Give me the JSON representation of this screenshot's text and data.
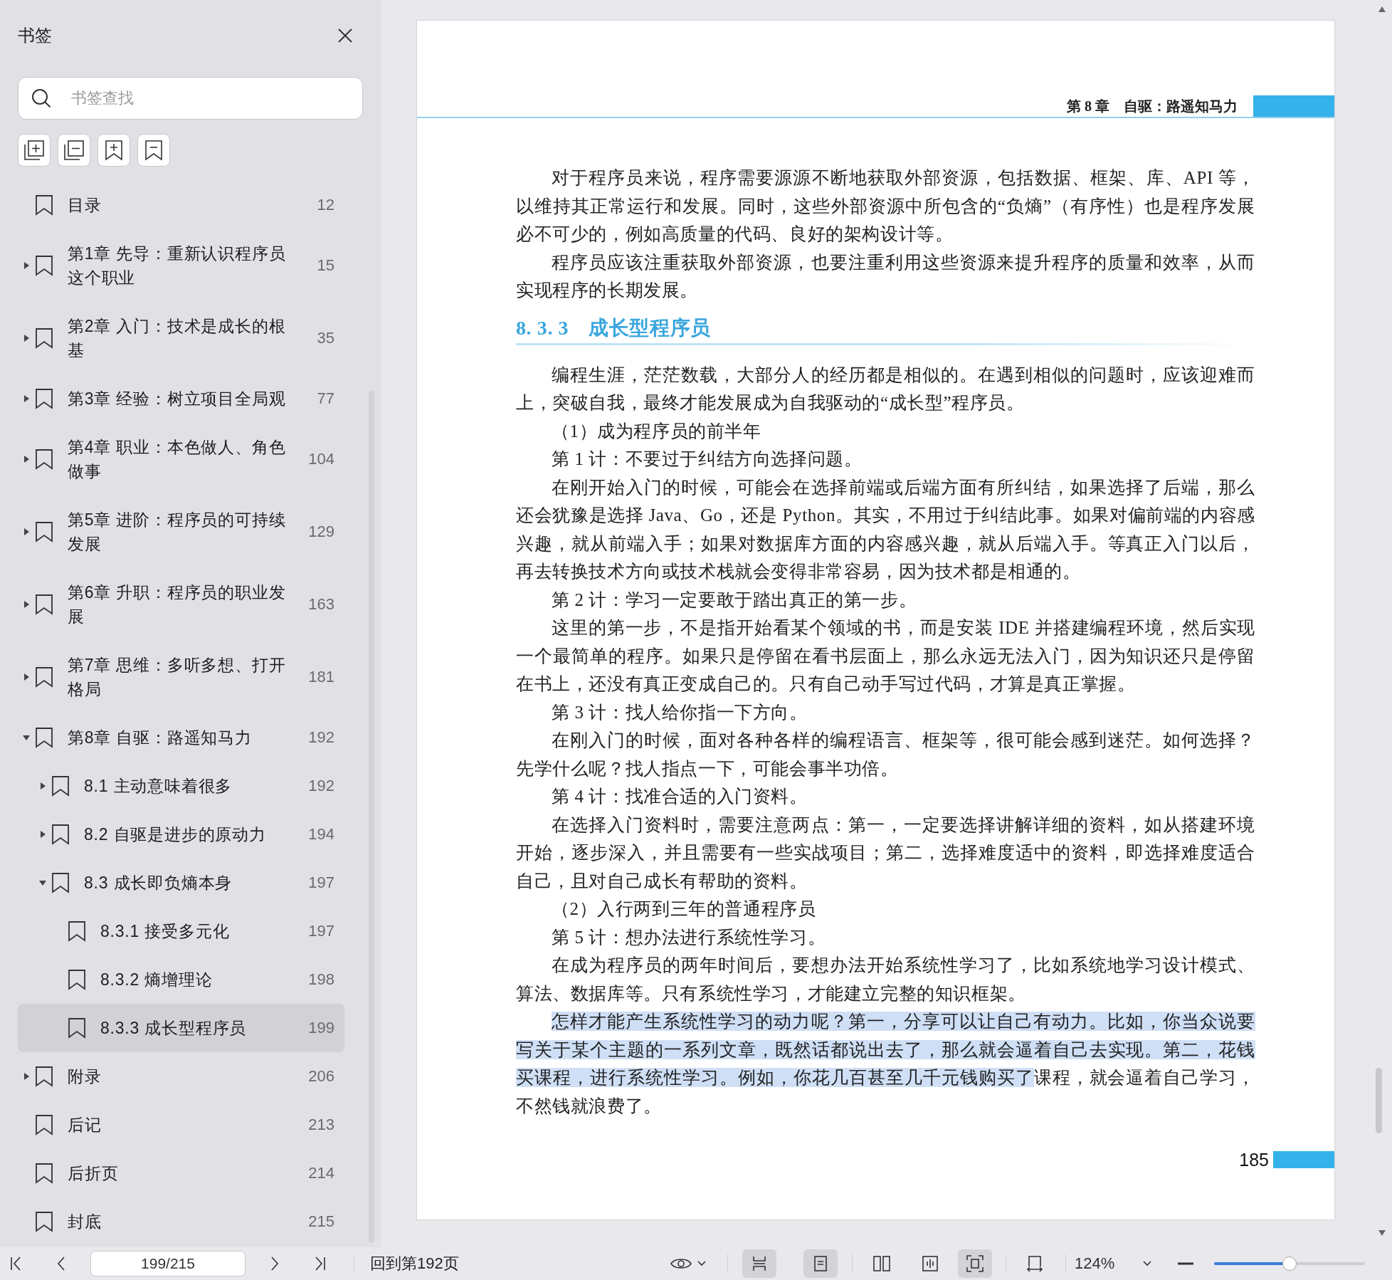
{
  "sidebar": {
    "title": "书签",
    "search": {
      "placeholder": "书签查找"
    },
    "bookmarks": [
      {
        "label": "目录",
        "page": "12",
        "selected": false
      },
      {
        "label": "第1章 先导：重新认识程序员这个职业",
        "page": "15",
        "selected": false,
        "expanded": false
      },
      {
        "label": "第2章 入门：技术是成长的根基",
        "page": "35",
        "selected": false,
        "expanded": false
      },
      {
        "label": "第3章 经验：树立项目全局观",
        "page": "77",
        "selected": false,
        "expanded": false
      },
      {
        "label": "第4章 职业：本色做人、角色做事",
        "page": "104",
        "selected": false,
        "expanded": false
      },
      {
        "label": "第5章 进阶：程序员的可持续发展",
        "page": "129",
        "selected": false,
        "expanded": false
      },
      {
        "label": "第6章 升职：程序员的职业发展",
        "page": "163",
        "selected": false,
        "expanded": false
      },
      {
        "label": "第7章 思维：多听多想、打开格局",
        "page": "181",
        "selected": false,
        "expanded": false
      },
      {
        "label": "第8章 自驱：路遥知马力",
        "page": "192",
        "selected": false,
        "expanded": true,
        "children": [
          {
            "label": "8.1 主动意味着很多",
            "page": "192",
            "selected": false,
            "expanded": false
          },
          {
            "label": "8.2 自驱是进步的原动力",
            "page": "194",
            "selected": false,
            "expanded": false
          },
          {
            "label": "8.3 成长即负熵本身",
            "page": "197",
            "selected": false,
            "expanded": true,
            "children": [
              {
                "label": "8.3.1 接受多元化",
                "page": "197",
                "selected": false
              },
              {
                "label": "8.3.2 熵增理论",
                "page": "198",
                "selected": false
              },
              {
                "label": "8.3.3 成长型程序员",
                "page": "199",
                "selected": true
              }
            ]
          }
        ]
      },
      {
        "label": "附录",
        "page": "206",
        "selected": false,
        "expanded": false
      },
      {
        "label": "后记",
        "page": "213",
        "selected": false
      },
      {
        "label": "后折页",
        "page": "214",
        "selected": false
      },
      {
        "label": "封底",
        "page": "215",
        "selected": false
      }
    ]
  },
  "page": {
    "running_head": "第 8 章　自驱：路遥知马力",
    "page_number": "185",
    "blocks": [
      {
        "kind": "paragraph",
        "text": "对于程序员来说，程序需要源源不断地获取外部资源，包括数据、框架、库、API 等，以维持其正常运行和发展。同时，这些外部资源中所包含的“负熵”（有序性）也是程序发展必不可少的，例如高质量的代码、良好的架构设计等。"
      },
      {
        "kind": "paragraph",
        "text": "程序员应该注重获取外部资源，也要注重利用这些资源来提升程序的质量和效率，从而实现程序的长期发展。"
      },
      {
        "kind": "heading",
        "number": "8. 3. 3",
        "text": "成长型程序员"
      },
      {
        "kind": "paragraph",
        "text": "编程生涯，茫茫数载，大部分人的经历都是相似的。在遇到相似的问题时，应该迎难而上，突破自我，最终才能发展成为自我驱动的“成长型”程序员。"
      },
      {
        "kind": "paragraph",
        "text": "（1）成为程序员的前半年"
      },
      {
        "kind": "paragraph",
        "text": "第 1 计：不要过于纠结方向选择问题。"
      },
      {
        "kind": "paragraph",
        "text": "在刚开始入门的时候，可能会在选择前端或后端方面有所纠结，如果选择了后端，那么还会犹豫是选择 Java、Go，还是 Python。其实，不用过于纠结此事。如果对偏前端的内容感兴趣，就从前端入手；如果对数据库方面的内容感兴趣，就从后端入手。等真正入门以后，再去转换技术方向或技术栈就会变得非常容易，因为技术都是相通的。"
      },
      {
        "kind": "paragraph",
        "text": "第 2 计：学习一定要敢于踏出真正的第一步。"
      },
      {
        "kind": "paragraph",
        "text": "这里的第一步，不是指开始看某个领域的书，而是安装 IDE 并搭建编程环境，然后实现一个最简单的程序。如果只是停留在看书层面上，那么永远无法入门，因为知识还只是停留在书上，还没有真正变成自己的。只有自己动手写过代码，才算是真正掌握。"
      },
      {
        "kind": "paragraph",
        "text": "第 3 计：找人给你指一下方向。"
      },
      {
        "kind": "paragraph",
        "text": "在刚入门的时候，面对各种各样的编程语言、框架等，很可能会感到迷茫。如何选择？先学什么呢？找人指点一下，可能会事半功倍。"
      },
      {
        "kind": "paragraph",
        "text": "第 4 计：找准合适的入门资料。"
      },
      {
        "kind": "paragraph",
        "text": "在选择入门资料时，需要注意两点：第一，一定要选择讲解详细的资料，如从搭建环境开始，逐步深入，并且需要有一些实战项目；第二，选择难度适中的资料，即选择难度适合自己，且对自己成长有帮助的资料。"
      },
      {
        "kind": "paragraph",
        "text": "（2）入行两到三年的普通程序员"
      },
      {
        "kind": "paragraph",
        "text": "第 5 计：想办法进行系统性学习。"
      },
      {
        "kind": "paragraph",
        "text": "在成为程序员的两年时间后，要想办法开始系统性学习了，比如系统地学习设计模式、算法、数据库等。只有系统性学习，才能建立完整的知识框架。"
      },
      {
        "kind": "paragraph",
        "segments": [
          {
            "text": "怎样才能产生系统性学习的动力呢？第一，分享可以让自己有动力。比如，你当众说要写关于某个主题的一系列文章，既然话都说出去了，那么就会逼着自己去实现。第二，花钱买课程，进行系统性学习。例如，你花几百甚至几千元钱购买了",
            "highlighted": true
          },
          {
            "text": "课程，就会逼着自己学习，不然钱就浪费了。",
            "highlighted": false
          }
        ]
      }
    ]
  },
  "toolbar": {
    "page_field": "199/215",
    "back_link": "回到第192页",
    "zoom": "124%",
    "zoom_slider": {
      "level": 0.5
    },
    "view_buttons": [
      {
        "kind": "continuous",
        "selected": true
      },
      {
        "kind": "single",
        "selected": true
      },
      {
        "kind": "double",
        "selected": false
      },
      {
        "kind": "book",
        "selected": false
      },
      {
        "kind": "fit",
        "selected": true
      },
      {
        "kind": "width",
        "selected": false
      }
    ]
  }
}
